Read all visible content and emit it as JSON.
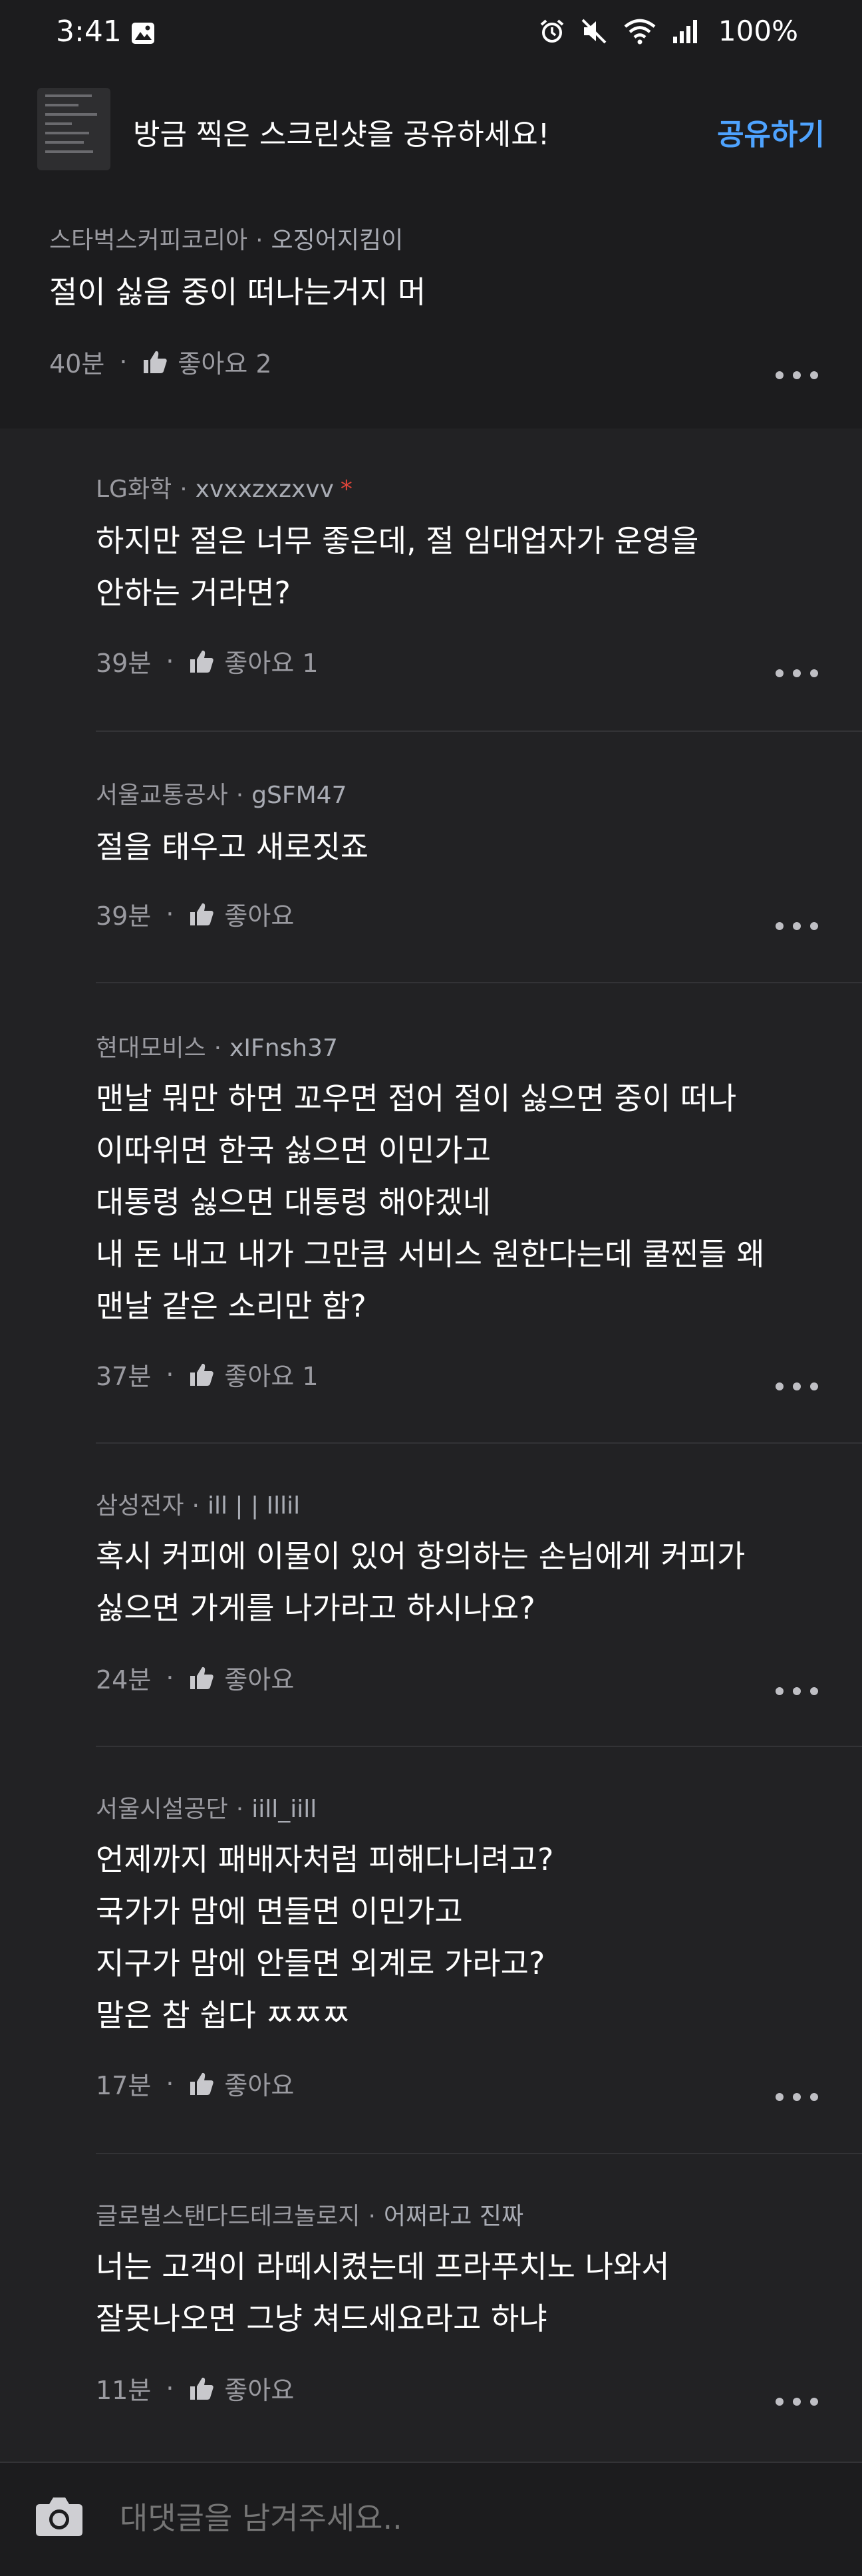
{
  "status": {
    "time": "3:41",
    "battery": "100%"
  },
  "share": {
    "text": "방금 찍은 스크린샷을 공유하세요!",
    "button": "공유하기"
  },
  "main_comment": {
    "company": "스타벅스커피코리아",
    "nickname": "오징어지킴이",
    "body": [
      "절이 싫음 중이 떠나는거지 머"
    ],
    "time": "40분",
    "like_label": "좋아요 2"
  },
  "replies": [
    {
      "company": "LG화학",
      "nickname": "xvxxzxzxvv",
      "starred": true,
      "body": [
        "하지만 절은 너무 좋은데, 절 임대업자가 운영을",
        "안하는 거라면?"
      ],
      "time": "39분",
      "like_label": "좋아요 1"
    },
    {
      "company": "서울교통공사",
      "nickname": "gSFM47",
      "starred": false,
      "body": [
        "절을 태우고 새로짓죠"
      ],
      "time": "39분",
      "like_label": "좋아요"
    },
    {
      "company": "현대모비스",
      "nickname": "xIFnsh37",
      "starred": false,
      "body": [
        "맨날 뭐만 하면 꼬우면 접어 절이 싫으면 중이 떠나",
        "이따위면 한국 싫으면 이민가고",
        "대통령 싫으면 대통령 해야겠네",
        "내 돈 내고 내가 그만큼 서비스 원한다는데 쿨찐들 왜",
        "맨날 같은 소리만 함?"
      ],
      "time": "37분",
      "like_label": "좋아요 1"
    },
    {
      "company": "삼성전자",
      "nickname": "ill |   | Illil",
      "starred": false,
      "body": [
        "혹시 커피에 이물이 있어 항의하는 손님에게 커피가",
        "싫으면 가게를 나가라고 하시나요?"
      ],
      "time": "24분",
      "like_label": "좋아요"
    },
    {
      "company": "서울시설공단",
      "nickname": "iill_iill",
      "starred": false,
      "body": [
        "언제까지 패배자처럼 피해다니려고?",
        "국가가 맘에 면들면 이민가고",
        "지구가 맘에 안들면 외계로 가라고?",
        "말은 참 쉽다 ㅉㅉㅉ"
      ],
      "time": "17분",
      "like_label": "좋아요"
    },
    {
      "company": "글로벌스탠다드테크놀로지",
      "nickname": "어쩌라고 진짜",
      "starred": false,
      "body": [
        "너는 고객이 라떼시켰는데 프라푸치노 나와서",
        "잘못나오면 그냥 쳐드세요라고 하냐"
      ],
      "time": "11분",
      "like_label": "좋아요"
    }
  ],
  "input": {
    "placeholder": "대댓글을 남겨주세요.."
  },
  "colors": {
    "background": "#1c1c1e",
    "reply_background": "#222224",
    "accent": "#4ea3ff",
    "meta": "#9a9aa0",
    "star": "#e0453a"
  },
  "icons": [
    "gallery-icon",
    "alarm-icon",
    "mute-icon",
    "wifi-icon",
    "signal-icon",
    "thumbs-up-icon",
    "more-icon",
    "camera-icon"
  ]
}
